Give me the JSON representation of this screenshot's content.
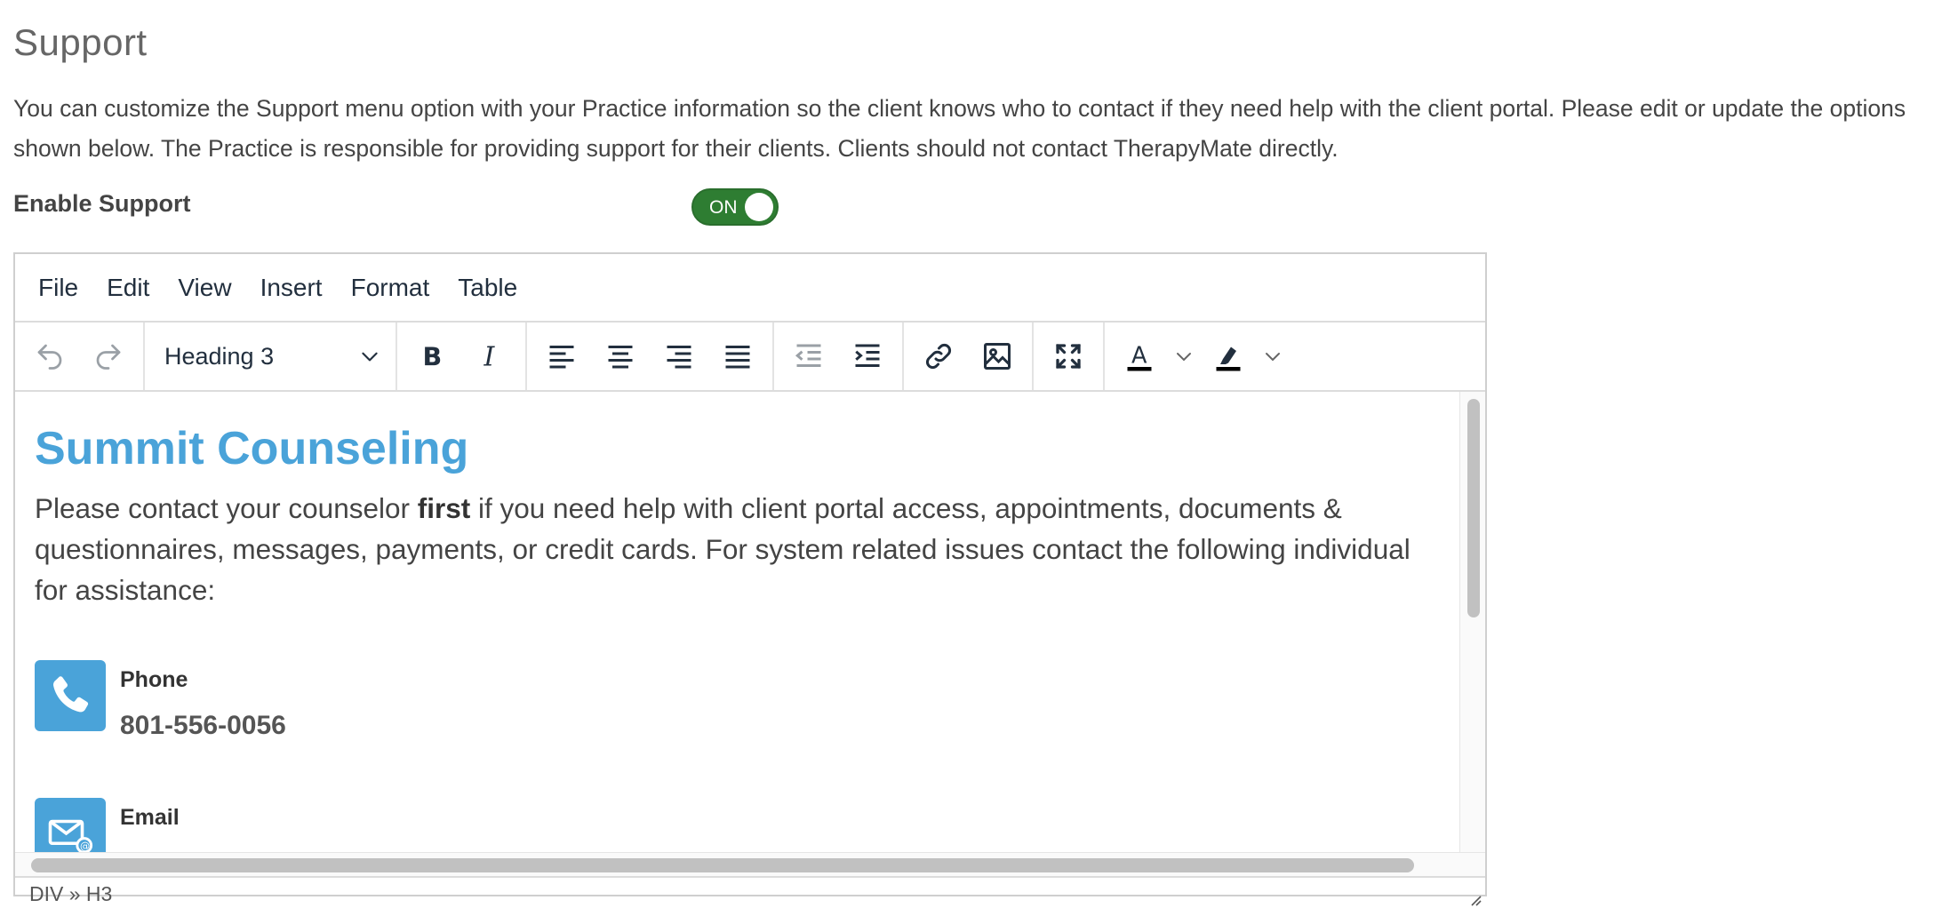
{
  "page": {
    "title": "Support",
    "description": "You can customize the Support menu option with your Practice information so the client knows who to contact if they need help with the client portal. Please edit or update the options shown below. The Practice is responsible for providing support for their clients. Clients should not contact TherapyMate directly."
  },
  "enable_support": {
    "label": "Enable Support",
    "state": "ON"
  },
  "editor": {
    "menu": [
      "File",
      "Edit",
      "View",
      "Insert",
      "Format",
      "Table"
    ],
    "block_format": "Heading 3",
    "content": {
      "heading": "Summit Counseling",
      "para_before_bold": "Please contact your counselor ",
      "para_bold": "first",
      "para_after_bold": " if you need help with client portal access, appointments, documents & questionnaires, messages, payments, or credit cards. For system related issues contact the following individual for assistance:",
      "contacts": [
        {
          "label": "Phone",
          "value": "801-556-0056",
          "icon": "phone-icon"
        },
        {
          "label": "Email",
          "value": "",
          "icon": "email-icon"
        }
      ]
    },
    "statusbar": {
      "path": "DIV » H3"
    }
  },
  "colors": {
    "toggle_on": "#2e7d32",
    "heading_blue": "#4aa3d9",
    "icon_tile": "#4aa3d9"
  }
}
